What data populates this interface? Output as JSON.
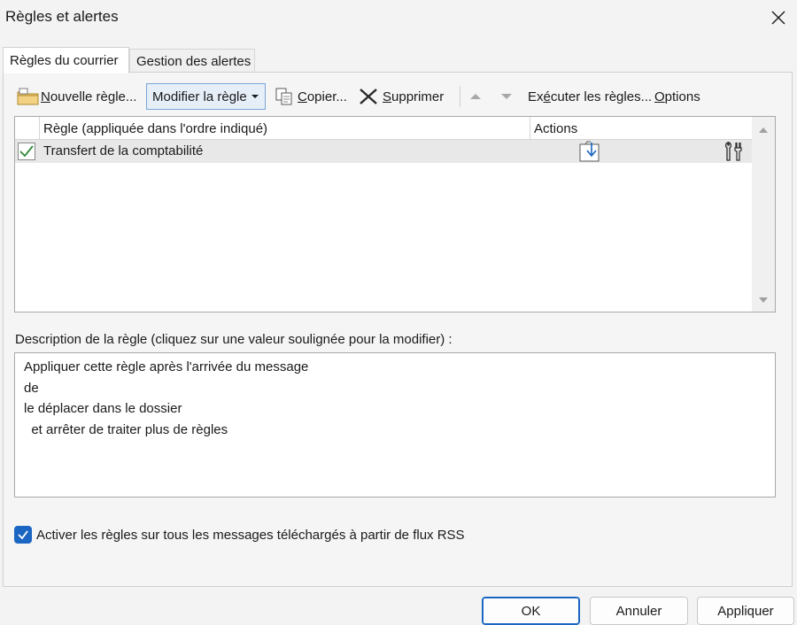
{
  "window": {
    "title": "Règles et alertes"
  },
  "tabs": [
    {
      "label": "Règles du courrier",
      "active": true
    },
    {
      "label": "Gestion des alertes",
      "active": false
    }
  ],
  "toolbar": {
    "new_rule": {
      "pre": "",
      "key": "N",
      "post": "ouvelle règle..."
    },
    "modify_rule": "Modifier la règle",
    "copy": {
      "pre": "",
      "key": "C",
      "post": "opier..."
    },
    "delete": {
      "pre": "",
      "key": "S",
      "post": "upprimer"
    },
    "run_rules": {
      "pre": "Ex",
      "key": "é",
      "post": "cuter les règles..."
    },
    "options": {
      "pre": "",
      "key": "O",
      "post": "ptions"
    }
  },
  "rules_list": {
    "columns": [
      "Règle (appliquée dans l'ordre indiqué)",
      "Actions"
    ],
    "rows": [
      {
        "name": "Transfert de la comptabilité",
        "enabled": true
      }
    ]
  },
  "description": {
    "label": "Description de la règle (cliquez sur une valeur soulignée pour la modifier) :",
    "lines": [
      "Appliquer cette règle après l'arrivée du message",
      "de",
      "le déplacer dans le dossier",
      "  et arrêter de traiter plus de règles"
    ]
  },
  "rss_option": {
    "label": "Activer les règles sur tous les messages téléchargés à partir de flux RSS",
    "checked": true
  },
  "buttons": {
    "ok": "OK",
    "cancel": "Annuler",
    "apply": "Appliquer"
  },
  "colors": {
    "accent": "#1a66c2",
    "selected_row": "#e8e8e8",
    "check_green": "#2e8b3a"
  },
  "icons": {
    "new_rule": "new-rule-folder-icon",
    "copy": "copy-icon",
    "delete": "delete-x-icon",
    "move_up": "arrow-up-icon",
    "move_down": "arrow-down-icon",
    "move_to_folder": "move-to-folder-icon",
    "rule_options": "tools-icon"
  }
}
